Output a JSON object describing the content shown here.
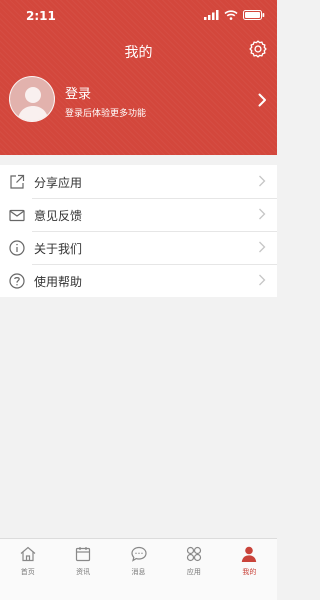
{
  "status_bar": {
    "time": "2:11"
  },
  "header": {
    "title": "我的"
  },
  "profile": {
    "login_label": "登录",
    "subtitle": "登录后体验更多功能"
  },
  "menu": {
    "items": [
      {
        "label": "分享应用",
        "icon": "share-icon"
      },
      {
        "label": "意见反馈",
        "icon": "envelope-icon"
      },
      {
        "label": "关于我们",
        "icon": "info-icon"
      },
      {
        "label": "使用帮助",
        "icon": "help-icon"
      }
    ]
  },
  "tabbar": {
    "active_index": 4,
    "items": [
      {
        "label": "首页",
        "icon": "home-icon"
      },
      {
        "label": "资讯",
        "icon": "calendar-icon"
      },
      {
        "label": "消息",
        "icon": "chat-icon"
      },
      {
        "label": "应用",
        "icon": "apps-icon"
      },
      {
        "label": "我的",
        "icon": "person-icon"
      }
    ]
  },
  "colors": {
    "accent": "#d3473c",
    "background": "#f2f2f2",
    "active_tab": "#c9433a",
    "inactive_tab": "#777777"
  }
}
